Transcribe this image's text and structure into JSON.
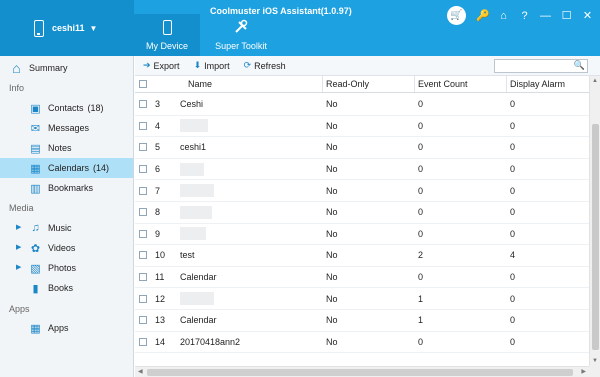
{
  "app": {
    "title": "Coolmuster iOS Assistant(1.0.97)",
    "device_name": "ceshi11",
    "device_caret": "▼"
  },
  "tabs": [
    {
      "label": "My Device",
      "icon": "phone-icon"
    },
    {
      "label": "Super Toolkit",
      "icon": "tools-icon"
    }
  ],
  "window_controls": {
    "cart": "🛒",
    "key": "🔑",
    "home": "⌂",
    "help": "?",
    "minimize": "—",
    "maximize": "☐",
    "close": "✕"
  },
  "sidebar": {
    "summary": "Summary",
    "section_info": "Info",
    "contacts": "Contacts",
    "contacts_count": "(18)",
    "messages": "Messages",
    "notes": "Notes",
    "calendars": "Calendars",
    "calendars_count": "(14)",
    "bookmarks": "Bookmarks",
    "section_media": "Media",
    "music": "Music",
    "videos": "Videos",
    "photos": "Photos",
    "books": "Books",
    "section_apps": "Apps",
    "apps": "Apps"
  },
  "toolbar": {
    "export": "Export",
    "import": "Import",
    "refresh": "Refresh",
    "search_placeholder": ""
  },
  "table": {
    "headers": {
      "name": "Name",
      "read_only": "Read-Only",
      "event_count": "Event Count",
      "display_alarm": "Display Alarm"
    },
    "rows": [
      {
        "num": "3",
        "name": "Ceshi",
        "read_only": "No",
        "event_count": "0",
        "display_alarm": "0"
      },
      {
        "num": "4",
        "name": "",
        "read_only": "No",
        "event_count": "0",
        "display_alarm": "0"
      },
      {
        "num": "5",
        "name": "ceshi1",
        "read_only": "No",
        "event_count": "0",
        "display_alarm": "0"
      },
      {
        "num": "6",
        "name": "",
        "read_only": "No",
        "event_count": "0",
        "display_alarm": "0"
      },
      {
        "num": "7",
        "name": "",
        "read_only": "No",
        "event_count": "0",
        "display_alarm": "0"
      },
      {
        "num": "8",
        "name": "",
        "read_only": "No",
        "event_count": "0",
        "display_alarm": "0"
      },
      {
        "num": "9",
        "name": "",
        "read_only": "No",
        "event_count": "0",
        "display_alarm": "0"
      },
      {
        "num": "10",
        "name": "test",
        "read_only": "No",
        "event_count": "2",
        "display_alarm": "4"
      },
      {
        "num": "11",
        "name": "Calendar",
        "read_only": "No",
        "event_count": "0",
        "display_alarm": "0"
      },
      {
        "num": "12",
        "name": "",
        "read_only": "No",
        "event_count": "1",
        "display_alarm": "0"
      },
      {
        "num": "13",
        "name": "Calendar",
        "read_only": "No",
        "event_count": "1",
        "display_alarm": "0"
      },
      {
        "num": "14",
        "name": "20170418ann2",
        "read_only": "No",
        "event_count": "0",
        "display_alarm": "0"
      }
    ]
  },
  "colors": {
    "title_bar": "#1da1e0",
    "active_tab": "#138fcd",
    "selected_item": "#aee0f7",
    "sidebar_bg": "#f2f5f8",
    "icon_blue": "#1b86c8"
  }
}
